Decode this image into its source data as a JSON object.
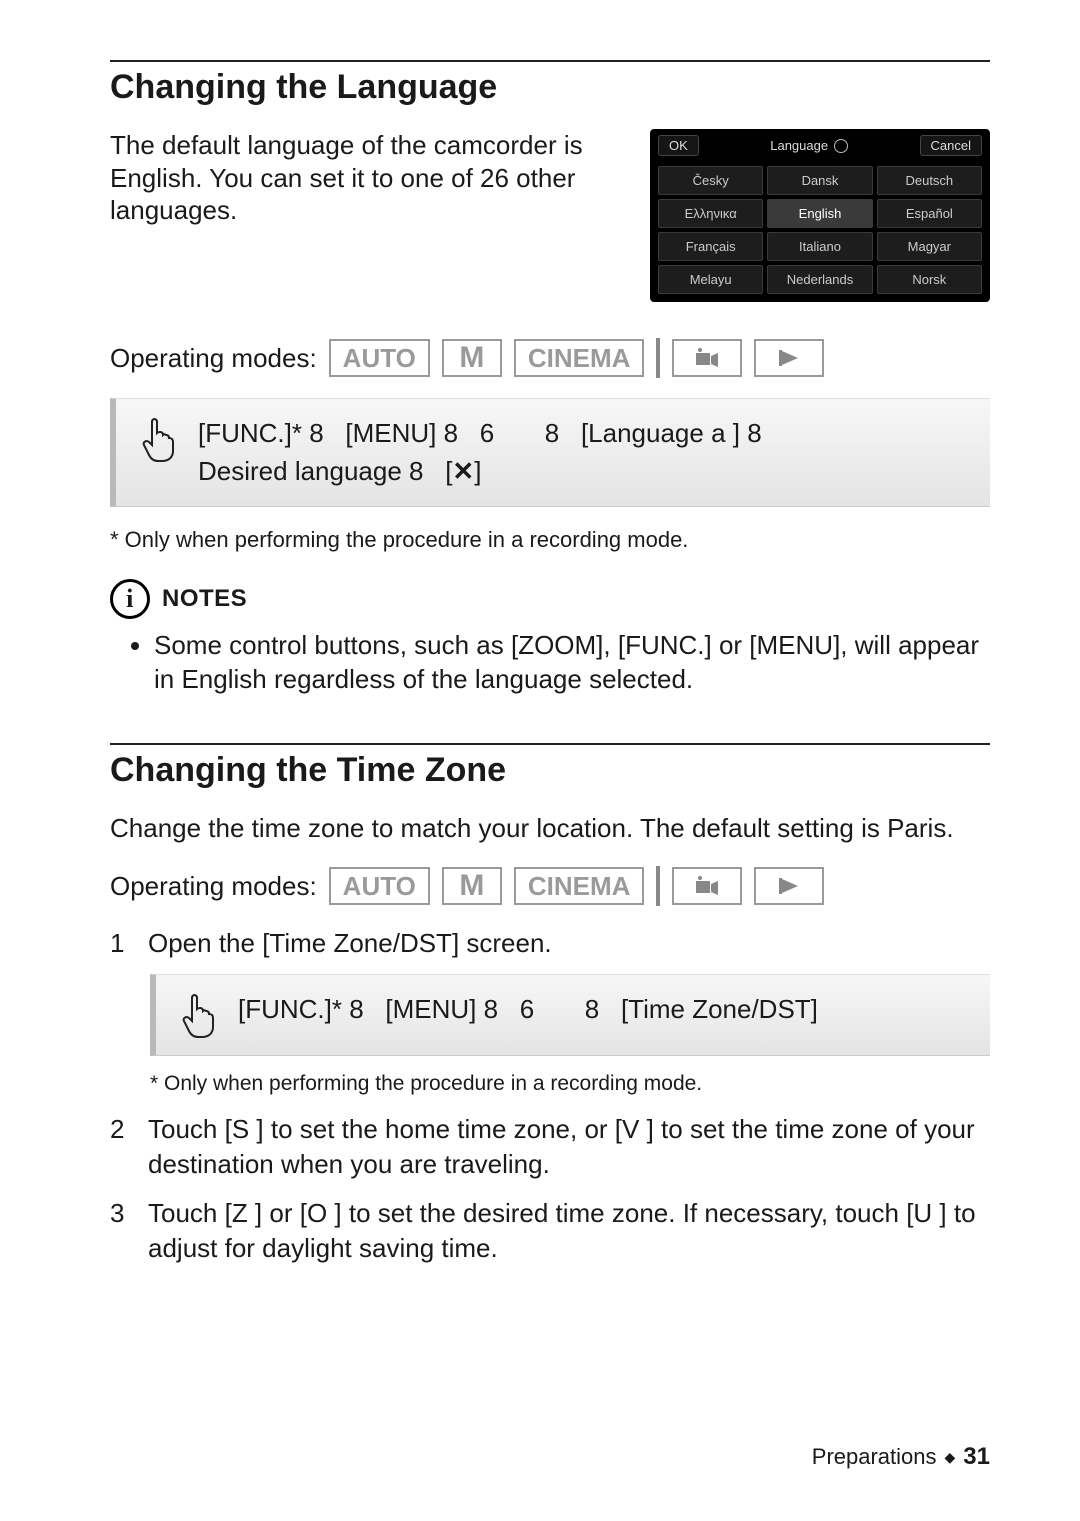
{
  "section1": {
    "heading": "Changing the Language",
    "intro": "The default language of the camcorder is English. You can set it to one of 26 other languages.",
    "lang_panel": {
      "ok": "OK",
      "title": "Language",
      "cancel": "Cancel",
      "cells": [
        "Česky",
        "Dansk",
        "Deutsch",
        "Ελληνικα",
        "English",
        "Español",
        "Français",
        "Italiano",
        "Magyar",
        "Melayu",
        "Nederlands",
        "Norsk"
      ],
      "selected_index": 4
    },
    "modes_label": "Operating modes:",
    "modes": {
      "auto": "AUTO",
      "m": "M",
      "cinema": "CINEMA"
    },
    "proc_parts": {
      "func": "[FUNC.]*",
      "c1": "8",
      "menu": "[MENU]",
      "c2": "8",
      "six": "6",
      "c3": "8",
      "lang": "[Language a    ]",
      "c4": "8",
      "desired": "Desired language",
      "c5": "8",
      "close_open": "[",
      "close_close": "]"
    },
    "footnote": "*  Only when performing the procedure in a recording mode.",
    "notes_label": "NOTES",
    "note_bullet": "Some control buttons, such as [ZOOM], [FUNC.] or [MENU], will appear in English regardless of the language selected."
  },
  "section2": {
    "heading": "Changing the Time Zone",
    "intro": "Change the time zone to match your location. The default setting is Paris.",
    "modes_label": "Operating modes:",
    "modes": {
      "auto": "AUTO",
      "m": "M",
      "cinema": "CINEMA"
    },
    "steps": {
      "s1_num": "1",
      "s1": "Open the [Time Zone/DST] screen.",
      "proc_parts": {
        "func": "[FUNC.]*",
        "c1": "8",
        "menu": "[MENU]",
        "c2": "8",
        "six": "6",
        "c3": "8",
        "tz": "[Time Zone/DST]"
      },
      "footnote": "*  Only when performing the procedure in a recording mode.",
      "s2_num": "2",
      "s2": "Touch [S  ] to set the home time zone, or [V  ] to set the time zone of your destination when you are traveling.",
      "s3_num": "3",
      "s3": "Touch [Z  ] or [O  ] to set the desired time zone. If necessary, touch [U  ] to adjust for daylight saving time."
    }
  },
  "footer": {
    "chapter": "Preparations",
    "diamond": "◆",
    "page": "31"
  }
}
